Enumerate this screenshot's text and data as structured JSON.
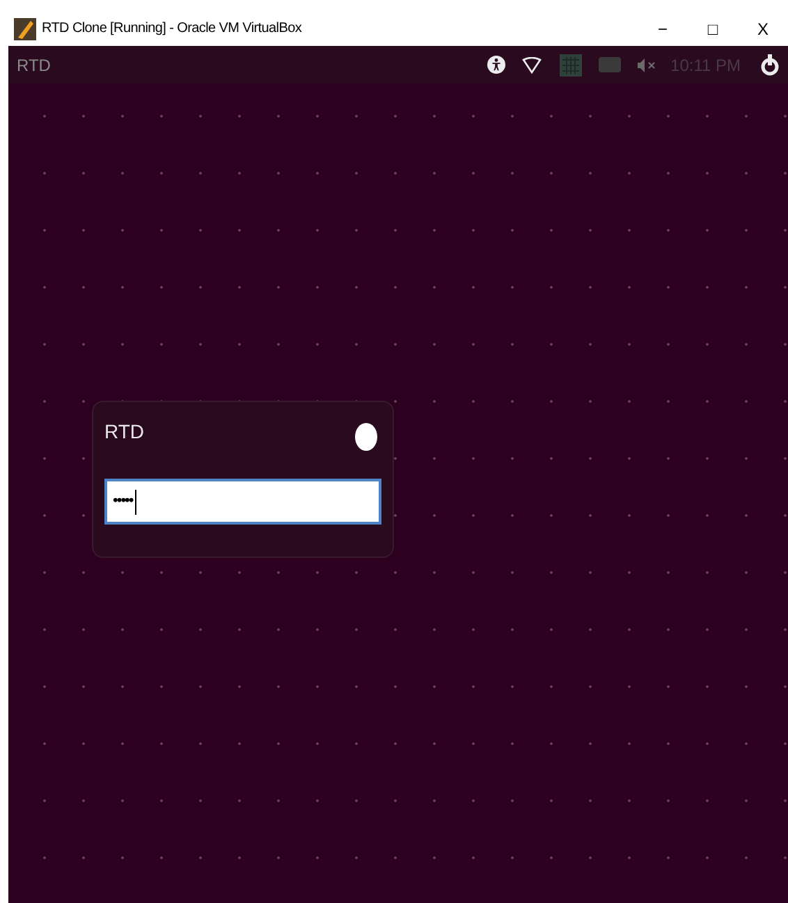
{
  "window": {
    "title": "RTD Clone [Running] - Oracle VM VirtualBox",
    "controls": [
      "−",
      "□",
      "X"
    ]
  },
  "top_panel": {
    "label": "RTD",
    "clock": "10:11 PM"
  },
  "login": {
    "user": "RTD",
    "password_value": "•••••"
  }
}
